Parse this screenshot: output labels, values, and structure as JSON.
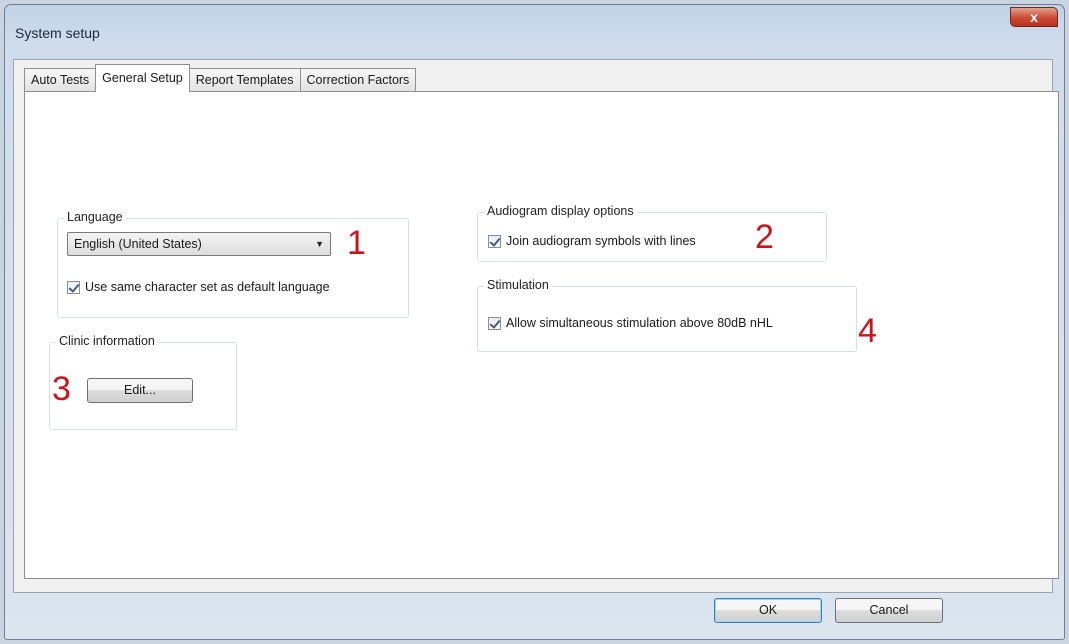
{
  "window": {
    "title": "System setup",
    "close_label": "x"
  },
  "tabs": [
    {
      "label": "Auto Tests",
      "active": false
    },
    {
      "label": "General Setup",
      "active": true
    },
    {
      "label": "Report Templates",
      "active": false
    },
    {
      "label": "Correction Factors",
      "active": false
    }
  ],
  "language_group": {
    "legend": "Language",
    "selected_language": "English (United States)",
    "charset_checkbox": {
      "label": "Use same character set as default language",
      "checked": true
    }
  },
  "clinic_group": {
    "legend": "Clinic information",
    "edit_label": "Edit..."
  },
  "audiogram_group": {
    "legend": "Audiogram display options",
    "join_checkbox": {
      "label": "Join audiogram symbols with lines",
      "checked": true
    }
  },
  "stimulation_group": {
    "legend": "Stimulation",
    "simultaneous_checkbox": {
      "label": "Allow simultaneous stimulation above 80dB nHL",
      "checked": true
    }
  },
  "callouts": {
    "one": "1",
    "two": "2",
    "three": "3",
    "four": "4"
  },
  "footer": {
    "ok_label": "OK",
    "cancel_label": "Cancel"
  },
  "colors": {
    "callout": "#c8151c",
    "panel": "#ffffff",
    "dialog": "#f0f0f0"
  }
}
